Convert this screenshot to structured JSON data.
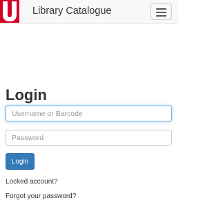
{
  "header": {
    "logo": {
      "letter": "U",
      "color": "#d6002a"
    },
    "title": "Library Catalogue",
    "menu_icon": "hamburger-menu-icon"
  },
  "login": {
    "heading": "Login",
    "username_placeholder": "Username or Barcode",
    "password_placeholder": "Password",
    "submit_label": "Login",
    "locked_link": "Locked account?",
    "forgot_link": "Forgot your password?"
  },
  "colors": {
    "brand": "#d6002a",
    "primary_button": "#337ab7",
    "focus_border": "#66afe9"
  }
}
